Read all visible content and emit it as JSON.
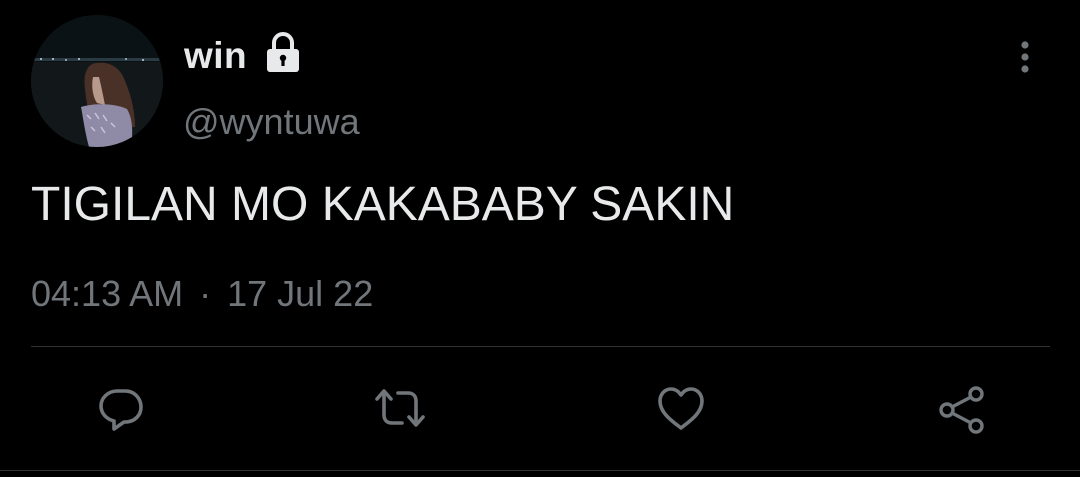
{
  "author": {
    "display_name": "win",
    "handle": "@wyntuwa",
    "protected": true
  },
  "tweet": {
    "text": "TIGILAN MO KAKABABY SAKIN",
    "time": "04:13 AM",
    "separator": "·",
    "date": "17 Jul 22"
  },
  "icons": {
    "lock": "lock-icon",
    "more": "more-vertical-icon",
    "reply": "reply-icon",
    "retweet": "retweet-icon",
    "like": "heart-icon",
    "share": "share-icon"
  },
  "colors": {
    "background": "#000000",
    "primary_text": "#e7e9ea",
    "secondary_text": "#71767b",
    "divider": "#2f3336"
  }
}
